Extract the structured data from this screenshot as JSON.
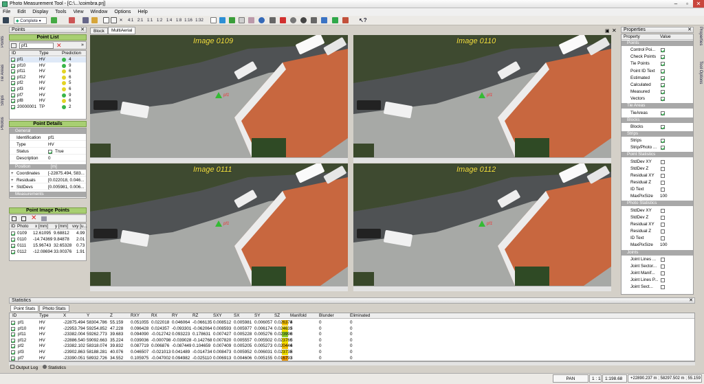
{
  "app": {
    "title": "Photo Measurement Tool - [C:\\...\\coimbra.prj]"
  },
  "menu": [
    "File",
    "Edit",
    "Display",
    "Tools",
    "View",
    "Window",
    "Options",
    "Help"
  ],
  "toolbar": {
    "mode": "Complete",
    "zoom_items": [
      "4:1",
      "2:1",
      "1:1",
      "1:2",
      "1:4",
      "1:8",
      "1:16",
      "1:32"
    ]
  },
  "left_tabs": [
    "Points",
    "Tie Areas",
    "Strips",
    "Photos"
  ],
  "right_tabs": [
    "Properties",
    "Tool Options"
  ],
  "points_panel": {
    "title": "Points",
    "list_header": "Point List",
    "filter": "pf1",
    "columns": [
      "ID",
      "Type",
      "Prediction"
    ],
    "rows": [
      {
        "id": "pf1",
        "type": "HV",
        "pred": "4",
        "color": "#39b54a"
      },
      {
        "id": "pf10",
        "type": "HV",
        "pred": "9",
        "color": "#39b54a"
      },
      {
        "id": "pf11",
        "type": "HV",
        "pred": "6",
        "color": "#e3d324"
      },
      {
        "id": "pf12",
        "type": "HV",
        "pred": "6",
        "color": "#e3d324"
      },
      {
        "id": "pf2",
        "type": "HV",
        "pred": "5",
        "color": "#e3d324"
      },
      {
        "id": "pf3",
        "type": "HV",
        "pred": "6",
        "color": "#e3d324"
      },
      {
        "id": "pf7",
        "type": "HV",
        "pred": "9",
        "color": "#39b54a"
      },
      {
        "id": "pf8",
        "type": "HV",
        "pred": "6",
        "color": "#e3d324"
      },
      {
        "id": "20000001",
        "type": "TP",
        "pred": "2",
        "color": "#39b54a"
      }
    ]
  },
  "point_details": {
    "header": "Point Details",
    "general": "General",
    "fields": [
      {
        "k": "Identification",
        "v": "pf1"
      },
      {
        "k": "Type",
        "v": "HV"
      },
      {
        "k": "Status",
        "v": "True"
      },
      {
        "k": "Description",
        "v": "0"
      }
    ],
    "position": "Position",
    "pos_unit": "[m]",
    "pos_fields": [
      {
        "k": "Coordinates",
        "v": "[-22875.494, 583..."
      },
      {
        "k": "Residuals",
        "v": "[0.022018, 0.046..."
      },
      {
        "k": "StdDevs",
        "v": "[0.005981, 0.006..."
      }
    ],
    "measurements": "Measurements"
  },
  "image_points": {
    "header": "Point Image Points",
    "columns": [
      "ID",
      "Photo",
      "x [mm]",
      "y [mm]",
      "vxy [u..."
    ],
    "rows": [
      {
        "photo": "0109",
        "x": "12.61095",
        "y": "9.68812",
        "v": "4.99"
      },
      {
        "photo": "0110",
        "x": "-14.74369",
        "y": "9.84878",
        "v": "2.01"
      },
      {
        "photo": "0111",
        "x": "15.96743",
        "y": "32.65328",
        "v": "0.73"
      },
      {
        "photo": "0112",
        "x": "-12.08694",
        "y": "33.00376",
        "v": "1.91"
      }
    ]
  },
  "views": {
    "tabs": [
      "Block",
      "MultiAerial"
    ],
    "images": [
      "Image 0109",
      "Image 0110",
      "Image 0111",
      "Image 0112"
    ],
    "point_label": "pf1"
  },
  "properties": {
    "title": "Properties",
    "columns": [
      "Property",
      "Value"
    ],
    "rows": [
      {
        "t": "sect",
        "l": "Points"
      },
      {
        "t": "p",
        "l": "Control Poi...",
        "c": true
      },
      {
        "t": "p",
        "l": "Check Points",
        "c": true
      },
      {
        "t": "p",
        "l": "Tie Points",
        "c": true
      },
      {
        "t": "p",
        "l": "Point ID Text",
        "c": true
      },
      {
        "t": "p",
        "l": "Estimated",
        "c": true
      },
      {
        "t": "p",
        "l": "Calculated",
        "c": true
      },
      {
        "t": "p",
        "l": "Measured",
        "c": true
      },
      {
        "t": "p",
        "l": "Vectors",
        "c": true
      },
      {
        "t": "sect",
        "l": "Tie Areas"
      },
      {
        "t": "p",
        "l": "TieAreas",
        "c": true
      },
      {
        "t": "sect",
        "l": "Blocks"
      },
      {
        "t": "p",
        "l": "Blocks",
        "c": true
      },
      {
        "t": "sect",
        "l": "Strips"
      },
      {
        "t": "p",
        "l": "Strips",
        "c": true
      },
      {
        "t": "p",
        "l": "Strip/Photo ...",
        "c": true
      },
      {
        "t": "sect",
        "l": "Point Statistics"
      },
      {
        "t": "p",
        "l": "StdDev XY",
        "c": false
      },
      {
        "t": "p",
        "l": "StdDev Z",
        "c": false
      },
      {
        "t": "p",
        "l": "Residual XY",
        "c": false
      },
      {
        "t": "p",
        "l": "Residual Z",
        "c": false
      },
      {
        "t": "p",
        "l": "ID Text",
        "c": false
      },
      {
        "t": "v",
        "l": "MaxPixSize",
        "v": "100"
      },
      {
        "t": "sect",
        "l": "Photo Statistics"
      },
      {
        "t": "p",
        "l": "StdDev XY",
        "c": false
      },
      {
        "t": "p",
        "l": "StdDev Z",
        "c": false
      },
      {
        "t": "p",
        "l": "Residual XY",
        "c": false
      },
      {
        "t": "p",
        "l": "Residual Z",
        "c": false
      },
      {
        "t": "p",
        "l": "ID Text",
        "c": false
      },
      {
        "t": "v",
        "l": "MaxPixSize",
        "v": "100"
      },
      {
        "t": "sect",
        "l": "Joints"
      },
      {
        "t": "p",
        "l": "Joint Lines ...",
        "c": false
      },
      {
        "t": "p",
        "l": "Joint Sector...",
        "c": false
      },
      {
        "t": "p",
        "l": "Joint Manif...",
        "c": false
      },
      {
        "t": "p",
        "l": "Joint Lines P...",
        "c": false
      },
      {
        "t": "p",
        "l": "Joint Sect...",
        "c": false
      }
    ]
  },
  "statistics": {
    "title": "Statistics",
    "tabs": [
      "Point Stats",
      "Photo Stats"
    ],
    "columns": [
      "ID",
      "Type",
      "X",
      "Y",
      "Z",
      "RXY",
      "RX",
      "RY",
      "RZ",
      "SXY",
      "SX",
      "SY",
      "SZ",
      "Manifold",
      "Blunder",
      "Eliminated"
    ],
    "rows": [
      {
        "id": "pf1",
        "type": "HV",
        "x": "-22875.494",
        "y": "58304.786",
        "z": "55.159",
        "rxy": "0.051055",
        "rx": "0.022018",
        "ry": "0.046064",
        "rz": "-0.066135",
        "sxy": "0.008512",
        "sx": "0.005981",
        "sy": "0.006057",
        "sz": "0.026378",
        "m": "4",
        "mc": "#f7c100",
        "b": "0",
        "e": "0"
      },
      {
        "id": "pf10",
        "type": "HV",
        "x": "-22953.794",
        "y": "59254.852",
        "z": "47.228",
        "rxy": "0.096428",
        "rx": "0.024357",
        "ry": "-0.093301",
        "rz": "-0.062064",
        "sxy": "0.008593",
        "sx": "0.005977",
        "sy": "0.006174",
        "sz": "0.024633",
        "m": "5",
        "mc": "#f0dc00",
        "b": "0",
        "e": "0"
      },
      {
        "id": "pf11",
        "type": "HV",
        "x": "-23382.004",
        "y": "59262.773",
        "z": "39.683",
        "rxy": "0.094090",
        "rx": "-0.012742",
        "ry": "0.093223",
        "rz": "0.178631",
        "sxy": "0.007427",
        "sx": "0.005228",
        "sy": "0.005276",
        "sz": "0.023990",
        "m": "8",
        "mc": "#8fcf2a",
        "b": "0",
        "e": "0"
      },
      {
        "id": "pf12",
        "type": "HV",
        "x": "-22886.540",
        "y": "59092.663",
        "z": "35.224",
        "rxy": "0.039036",
        "rx": "-0.000798",
        "ry": "-0.039028",
        "rz": "-0.142768",
        "sxy": "0.007820",
        "sx": "0.005557",
        "sy": "0.005502",
        "sz": "0.023760",
        "m": "5",
        "mc": "#f0dc00",
        "b": "0",
        "e": "0"
      },
      {
        "id": "pf2",
        "type": "HV",
        "x": "-23382.102",
        "y": "58318.074",
        "z": "39.832",
        "rxy": "0.087719",
        "rx": "0.006876",
        "ry": "-0.087449",
        "rz": "0.104659",
        "sxy": "0.007409",
        "sx": "0.005205",
        "sy": "0.005273",
        "sz": "0.020446",
        "m": "4",
        "mc": "#f7c100",
        "b": "0",
        "e": "0"
      },
      {
        "id": "pf3",
        "type": "HV",
        "x": "-23902.863",
        "y": "58188.281",
        "z": "40.076",
        "rxy": "0.046507",
        "rx": "-0.021013",
        "ry": "0.041489",
        "rz": "-0.014734",
        "sxy": "0.008473",
        "sx": "0.005952",
        "sy": "0.006031",
        "sz": "0.023738",
        "m": "5",
        "mc": "#f0dc00",
        "b": "0",
        "e": "0"
      },
      {
        "id": "pf7",
        "type": "HV",
        "x": "-23390.051",
        "y": "58932.726",
        "z": "34.552",
        "rxy": "0.105975",
        "rx": "-0.047002",
        "ry": "0.094982",
        "rz": "-0.025110",
        "sxy": "0.006913",
        "sx": "0.004606",
        "sy": "0.005155",
        "sz": "0.016793",
        "m": "3",
        "mc": "#f29a00",
        "b": "0",
        "e": "0"
      }
    ]
  },
  "bottom_tabs": [
    "Output Log",
    "Statistics"
  ],
  "status": {
    "mode": "PAN",
    "scale": "1 : 1",
    "zoom": "1:198.68",
    "coords": "+22890.237 m ; 58297.502 m ; 55.159 m"
  }
}
